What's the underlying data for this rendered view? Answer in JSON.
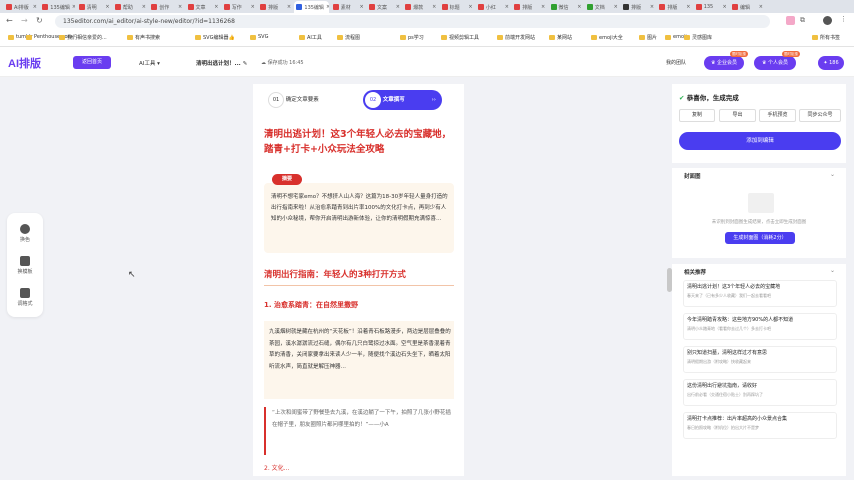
{
  "browser": {
    "tabs": [
      {
        "label": "Ai排版",
        "color": "#e04040"
      },
      {
        "label": "135编辑",
        "color": "#e04040"
      },
      {
        "label": "清明",
        "color": "#e04040"
      },
      {
        "label": "帮助",
        "color": "#e04040"
      },
      {
        "label": "创作",
        "color": "#e04040"
      },
      {
        "label": "文章",
        "color": "#e04040"
      },
      {
        "label": "写作",
        "color": "#e04040"
      },
      {
        "label": "排版",
        "color": "#e04040"
      },
      {
        "label": "135编辑",
        "color": "#3060e0"
      },
      {
        "label": "素材",
        "color": "#e04040"
      },
      {
        "label": "文案",
        "color": "#e04040"
      },
      {
        "label": "爆款",
        "color": "#e04040"
      },
      {
        "label": "标题",
        "color": "#e04040"
      },
      {
        "label": "小红",
        "color": "#e04040"
      },
      {
        "label": "排版",
        "color": "#e04040"
      },
      {
        "label": "微信",
        "color": "#30a030"
      },
      {
        "label": "文档",
        "color": "#30a030"
      },
      {
        "label": "排版",
        "color": "#333333"
      },
      {
        "label": "排版",
        "color": "#e04040"
      },
      {
        "label": "135",
        "color": "#e04040"
      },
      {
        "label": "编辑",
        "color": "#e04040"
      }
    ],
    "url": "135editor.com/ai_editor/ai-style-new/editor/?id=1136268",
    "bookmarks": [
      "tumblr",
      "Penthouse.com -...",
      "我们相信亲爱的...",
      "有声书搜索",
      "SVG编辑器👍",
      "SVG",
      "AI工具",
      "流程图",
      "ps学习",
      "视频剪辑工具",
      "前端开发网站",
      "某网站",
      "emoji大全",
      "图片",
      "emoji",
      "灵感图库"
    ],
    "bookmark_right": "所有书签"
  },
  "app": {
    "logo": "AI排版",
    "back_label": "返回首页",
    "ai_tools": "AI工具",
    "doc_title": "清明出逃计划！...",
    "save_status": "保存成功 16:45",
    "team_label": "我的团队",
    "enterprise_label": "企业会员",
    "personal_label": "个人会员",
    "coins": "186",
    "badge1": "限时钜惠",
    "badge2": "限时钜惠"
  },
  "left_tools": [
    {
      "label": "换色",
      "icon": "palette-icon"
    },
    {
      "label": "换模板",
      "icon": "template-icon"
    },
    {
      "label": "调格式",
      "icon": "format-icon"
    }
  ],
  "steps": [
    {
      "num": "01",
      "label": "确定文章要素"
    },
    {
      "num": "02",
      "label": "文章撰写"
    }
  ],
  "article": {
    "title": "清明出逃计划！这3个年轻人必去的宝藏地，踏青+打卡+小众玩法全攻略",
    "abstract_tag": "摘要",
    "abstract": "清明不想宅家emo？不想挤人山人海？这篇为18-30岁年轻人量身打造的出行指南来啦！从治愈系踏青到出片率100%的文化打卡点，再到少有人知的小众秘境，帮你开启清明出游新体验，让你的清明假期充满惊喜…",
    "section1": "清明出行指南：年轻人的3种打开方式",
    "sub1": "1. 治愈系踏青：在自然里撒野",
    "para1": "九溪烟树就是藏在杭州的“天花板”！沿着青石板路漫步，两边是层层叠叠的茶园，溪水潺潺流过石缝，偶尔有几只白鹭掠过水面。空气里是茶香混着青草的清香，关闭家要拿出来读人少一半，随便找个溪边石头坐下，晒着太阳听流水声，简直就是解压神器…",
    "quote": "“上次和闺蜜带了野餐垫去九溪，在溪边躺了一下午，拍照了几张小野花插在帽子里，朋友圈照片都问哪里拍的！”——小A",
    "more": "2. 文化…"
  },
  "right": {
    "done": "恭喜你，生成完成",
    "tabs": [
      "复制",
      "导出",
      "手机预览",
      "同步公众号"
    ],
    "generate_label": "添加到编辑",
    "cover_title": "封面图",
    "cover_hint": "未识别到封面图生成结果，点击立即生成封面图",
    "cover_button": "生成封面图（消耗2分）",
    "related_title": "相关推荐",
    "cards": [
      {
        "title": "清明出逃计划！这3个年轻人必去的宝藏地",
        "sub": "春天来了（已有多少人收藏）我们一起去看看吧"
      },
      {
        "title": "今年清明踏青攻略：这些地方90%的人都不知道",
        "sub": "清明小众踏青地（看看你去过几个）多去打卡吧"
      },
      {
        "title": "别只知道扫墓，清明这样过才有意思",
        "sub": "清明假期出游（附攻略）快收藏起来"
      },
      {
        "title": "这份清明出行避坑指南，请收好",
        "sub": "出行前必看（交通住宿小贴士）别再踩坑了"
      },
      {
        "title": "清明打卡点推荐：出片率超高的小众景点合集",
        "sub": "春日拍照攻略（附机位）拍出大片不是梦"
      }
    ]
  }
}
